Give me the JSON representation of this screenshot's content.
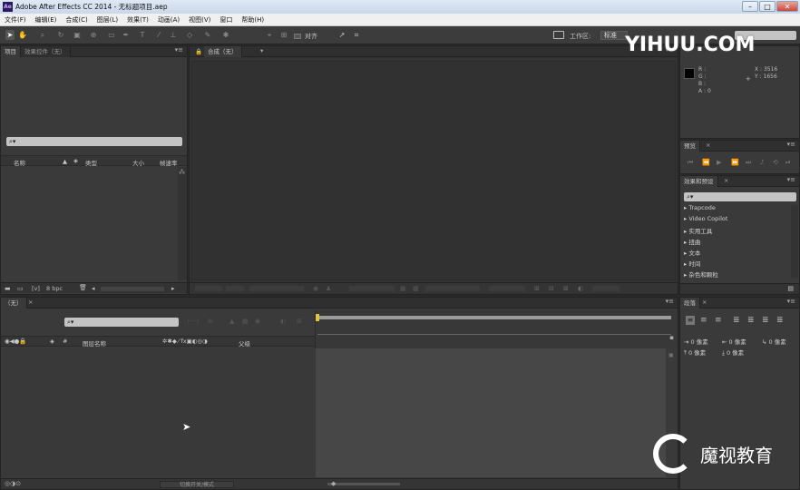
{
  "titlebar": {
    "title": "Adobe After Effects CC 2014 - 无标题项目.aep",
    "minimize": "–",
    "maximize": "□",
    "close": "✕"
  },
  "menubar": {
    "items": [
      "文件(F)",
      "编辑(E)",
      "合成(C)",
      "图层(L)",
      "效果(T)",
      "动画(A)",
      "视图(V)",
      "窗口",
      "帮助(H)"
    ]
  },
  "toolbar": {
    "align_label": "对齐",
    "workspace_label": "工作区:",
    "workspace_value": "标准"
  },
  "project_panel": {
    "tab_project": "项目",
    "tab_effect_controls": "效果控件（无）",
    "search_placeholder": "⌕▾",
    "columns": [
      "名称",
      "类型",
      "大小",
      "帧速率"
    ],
    "footer_bpc": "8 bpc"
  },
  "comp_panel": {
    "tab_label": "合成（无）"
  },
  "info_panel": {
    "r_label": "R :",
    "g_label": "G :",
    "b_label": "B :",
    "a_label": "A : 0",
    "x_label": "X : 3516",
    "y_label": "Y : 1656"
  },
  "preview_panel": {
    "tab_label": "预览"
  },
  "effects_panel": {
    "tab_label": "效果和预设",
    "search_placeholder": "⌕▾",
    "items": [
      "Trapcode",
      "Video Copilot",
      "实用工具",
      "扭曲",
      "文本",
      "时间",
      "杂色和颗粒"
    ]
  },
  "timeline_panel": {
    "tab_label": "（无）",
    "search_placeholder": "⌕▾",
    "layer_name_col": "图层名称",
    "parent_col": "父级",
    "bottom_toggle": "切换开关/模式"
  },
  "paragraph_panel": {
    "tab_label": "段落",
    "indent_values": [
      "0 像素",
      "0 像素",
      "0 像素",
      "0 像素",
      "0 像素"
    ]
  },
  "watermarks": {
    "top": "YIHUU.COM",
    "bottom": "魔视教育"
  }
}
